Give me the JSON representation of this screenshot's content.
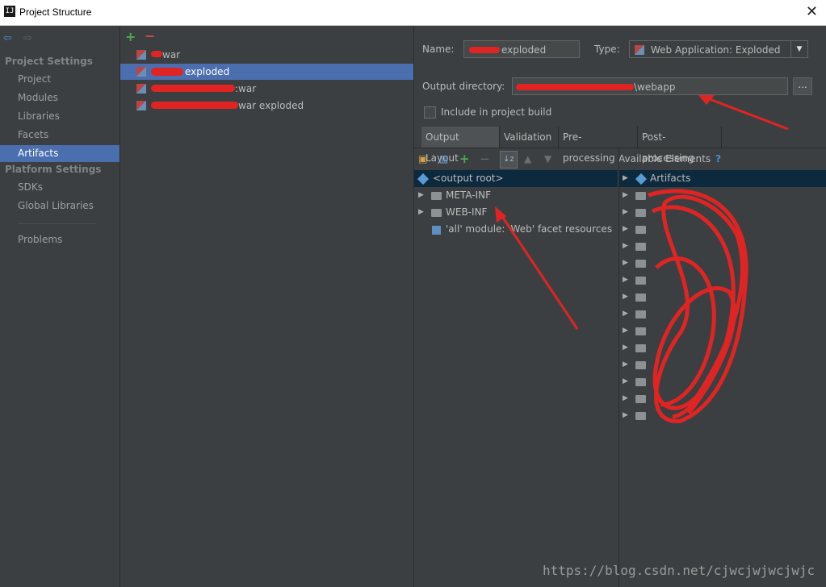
{
  "window": {
    "title": "Project Structure",
    "close_glyph": "✕"
  },
  "nav": {
    "back_glyph": "⇦",
    "forward_glyph": "⇨",
    "project_settings_header": "Project Settings",
    "project_settings": [
      "Project",
      "Modules",
      "Libraries",
      "Facets",
      "Artifacts"
    ],
    "platform_settings_header": "Platform Settings",
    "platform_settings": [
      "SDKs",
      "Global Libraries"
    ],
    "problems": "Problems",
    "selected": "Artifacts"
  },
  "artifacts_toolbar": {
    "add": "+",
    "remove": "−"
  },
  "artifacts": [
    {
      "label": "war"
    },
    {
      "label": "exploded",
      "selected": true
    },
    {
      "label": ":war"
    },
    {
      "label": "war exploded"
    }
  ],
  "form": {
    "name_label": "Name:",
    "name_value": "exploded",
    "type_label": "Type:",
    "type_value": "Web Application: Exploded",
    "output_label": "Output directory:",
    "output_value": "\\webapp",
    "browse": "...",
    "include_label": "Include in project build",
    "include_checked": false
  },
  "tabs": [
    "Output Layout",
    "Validation",
    "Pre-processing",
    "Post-processing"
  ],
  "layout_tree": [
    {
      "label": "<output root>",
      "icon": "diamond-icon",
      "selected": true
    },
    {
      "label": "META-INF",
      "icon": "folder-icon"
    },
    {
      "label": "WEB-INF",
      "icon": "folder-icon"
    },
    {
      "label": "'all' module: 'Web' facet resources",
      "icon": "module-icon"
    }
  ],
  "available": {
    "header": "Available Elements",
    "help": "?",
    "items": [
      "Artifacts",
      "",
      "",
      "",
      "",
      "",
      "",
      "",
      "",
      "",
      "",
      "",
      "",
      "",
      ""
    ]
  },
  "watermark": "https://blog.csdn.net/cjwcjwjwcjwjc",
  "colors": {
    "selection": "#4b6eaf",
    "annotation_red": "#e02424"
  }
}
